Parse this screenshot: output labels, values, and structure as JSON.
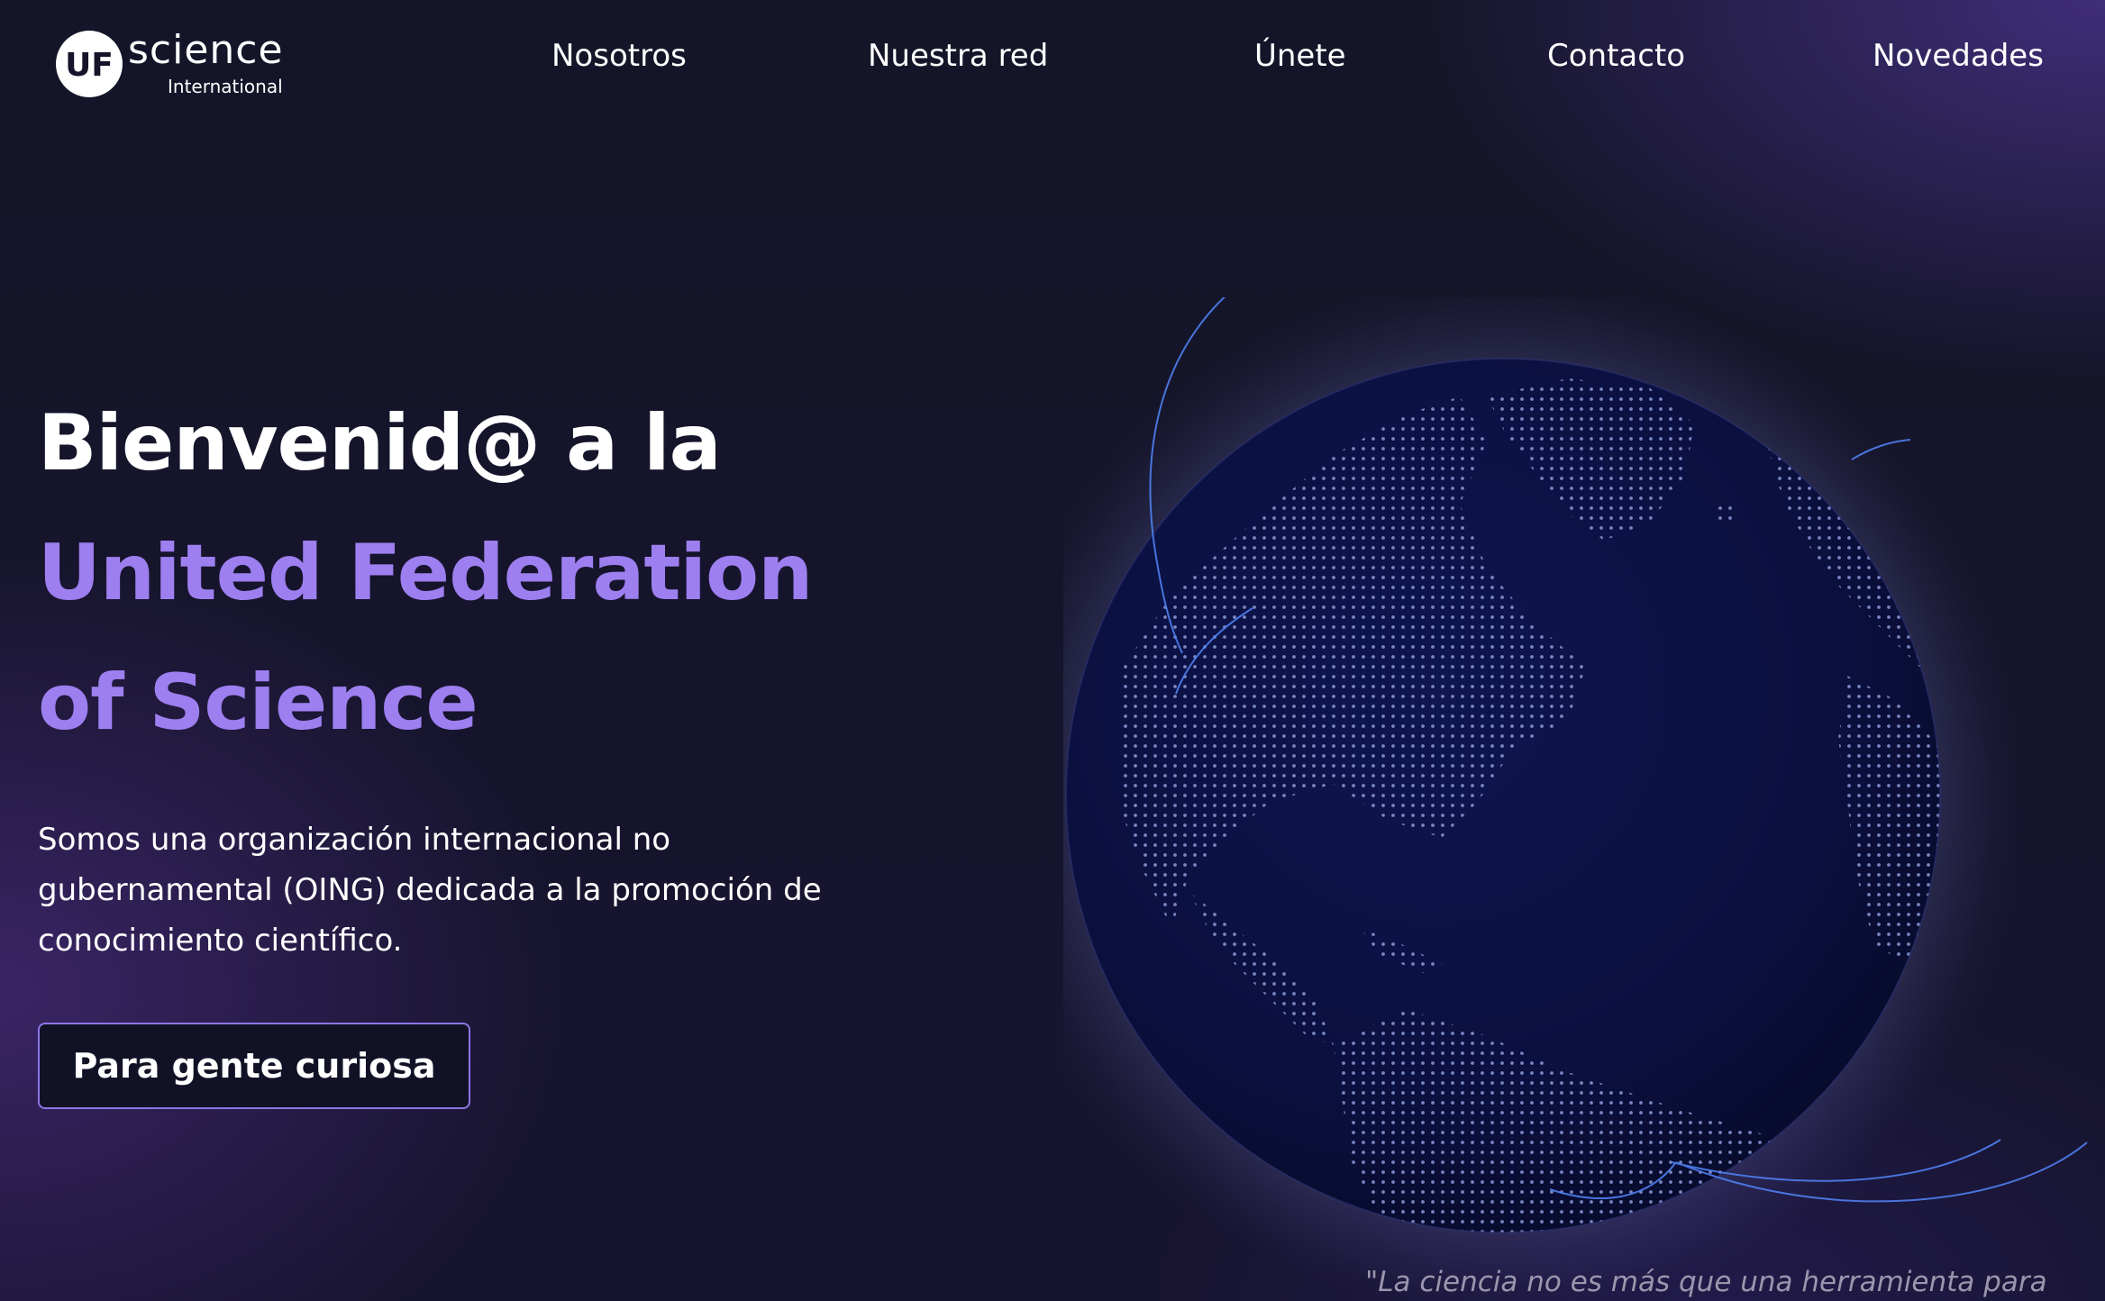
{
  "brand": {
    "badge_letters": "UF",
    "word": "science",
    "sub": "International"
  },
  "nav": {
    "items": [
      {
        "label": "Nosotros"
      },
      {
        "label": "Nuestra red"
      },
      {
        "label": "Únete"
      },
      {
        "label": "Contacto"
      },
      {
        "label": "Novedades"
      }
    ]
  },
  "hero": {
    "title_line1": "Bienvenid@ a la",
    "title_line2": "United Federation",
    "title_line3": "of Science",
    "description": "Somos una organización internacional no gubernamental (OING) dedicada a la promoción de conocimiento científico.",
    "cta_label": "Para gente curiosa"
  },
  "quote": {
    "text": "\"La ciencia no es más que una herramienta para"
  },
  "colors": {
    "accent_purple": "#9d7ff0",
    "button_border": "#8c76e6",
    "globe_fill": "#0c1140",
    "orbit_blue": "#4f7ff0",
    "background": "#15142a"
  },
  "icons": {
    "logo": "uf-science-logo",
    "globe": "earth-globe-illustration"
  }
}
